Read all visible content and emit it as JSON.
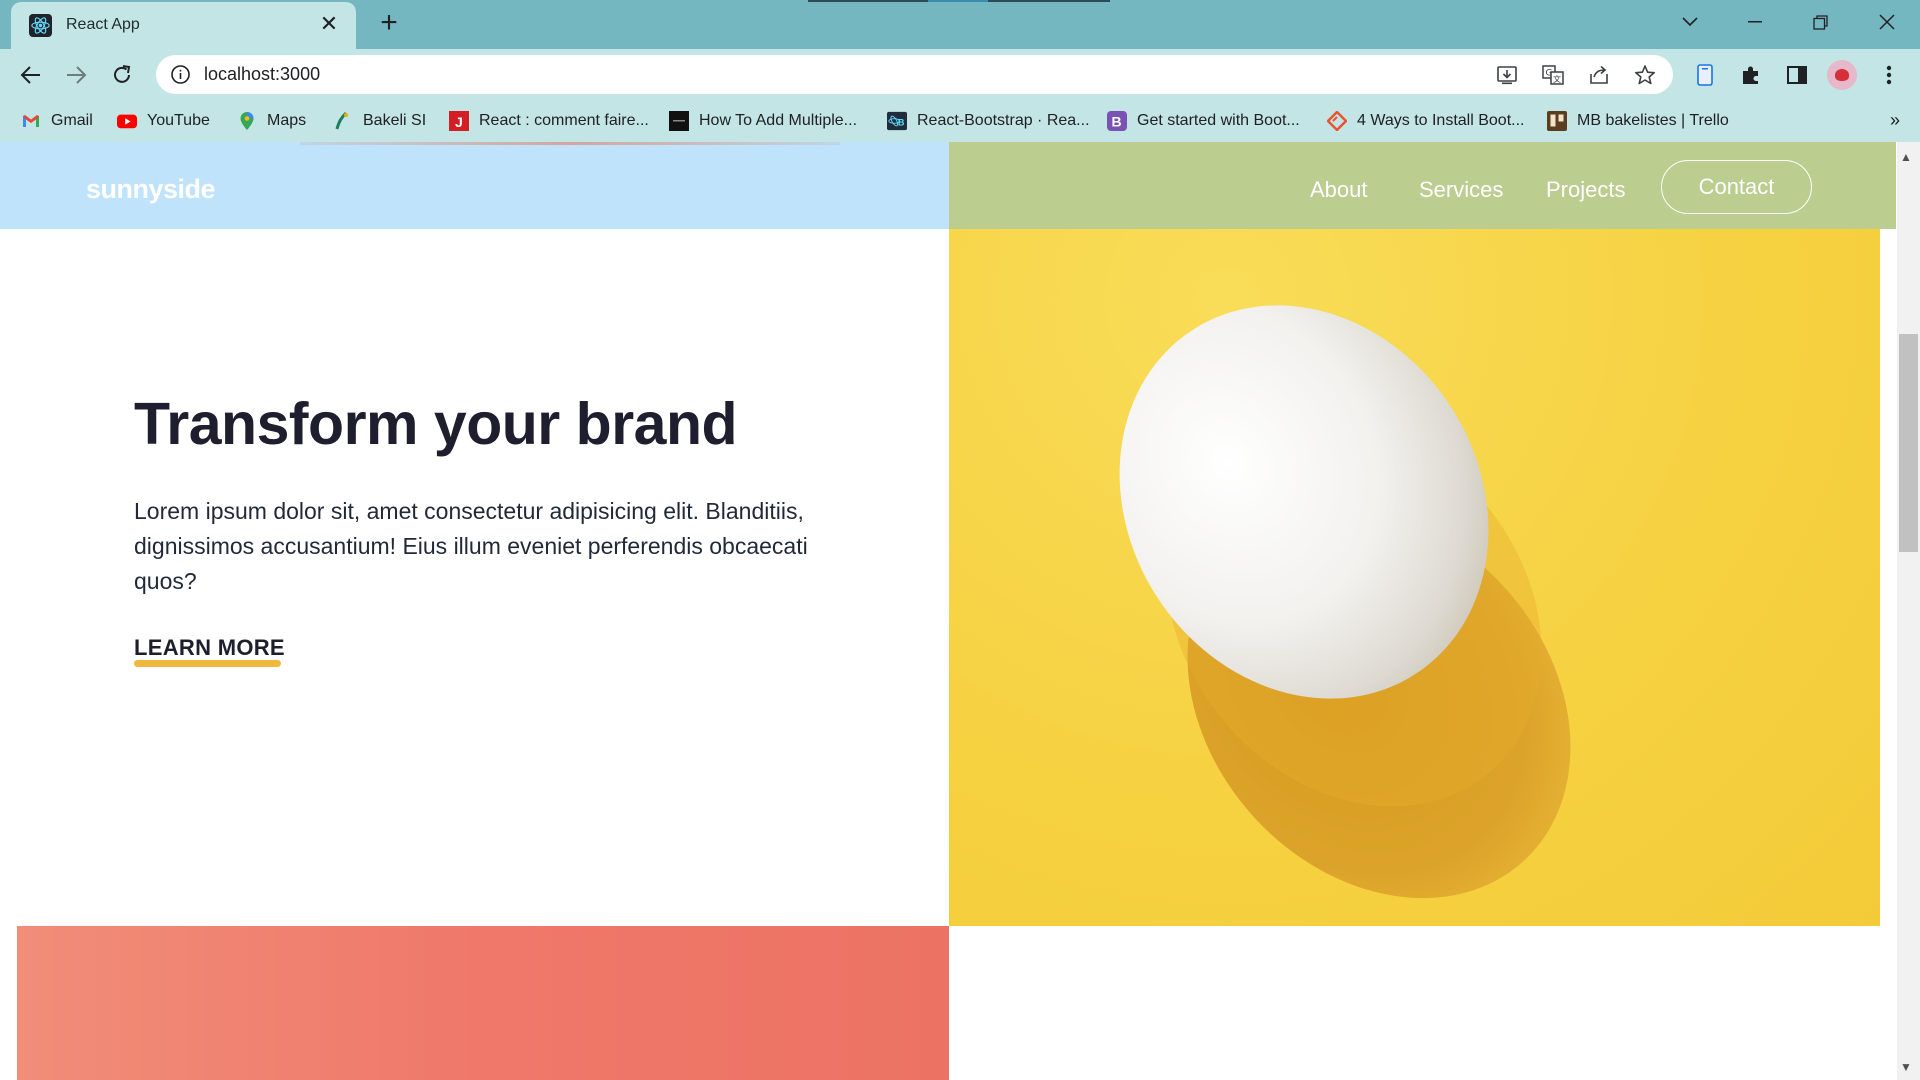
{
  "browser": {
    "tab_title": "React App",
    "url": "localhost:3000",
    "bookmarks": [
      {
        "label": "Gmail",
        "icon": "gmail-icon"
      },
      {
        "label": "YouTube",
        "icon": "youtube-icon"
      },
      {
        "label": "Maps",
        "icon": "maps-icon"
      },
      {
        "label": "Bakeli SI",
        "icon": "bakeli-icon"
      },
      {
        "label": "React : comment faire...",
        "icon": "j-icon"
      },
      {
        "label": "How To Add Multiple...",
        "icon": "dark-square-icon"
      },
      {
        "label": "React-Bootstrap · Rea...",
        "icon": "react-bootstrap-icon"
      },
      {
        "label": "Get started with Boot...",
        "icon": "bootstrap-icon"
      },
      {
        "label": "4 Ways to Install Boot...",
        "icon": "diamond-icon"
      },
      {
        "label": "MB bakelistes | Trello",
        "icon": "trello-icon"
      }
    ],
    "colors": {
      "tabstrip": "#74b7c0",
      "toolbar": "#c4e5e6"
    }
  },
  "site": {
    "logo": "sunnyside",
    "nav": {
      "about": "About",
      "services": "Services",
      "projects": "Projects",
      "contact": "Contact"
    },
    "hero": {
      "headline": "Transform your brand",
      "body": "Lorem ipsum dolor sit, amet consectetur adipisicing elit. Blanditiis, dignissimos accusantium! Eius illum eveniet perferendis obcaecati quos?",
      "cta": "LEARN MORE"
    },
    "colors": {
      "yellow": "#f7d448",
      "coral": "#ef786a",
      "underline": "#f1b93c",
      "heading": "#1f1e2f"
    }
  }
}
